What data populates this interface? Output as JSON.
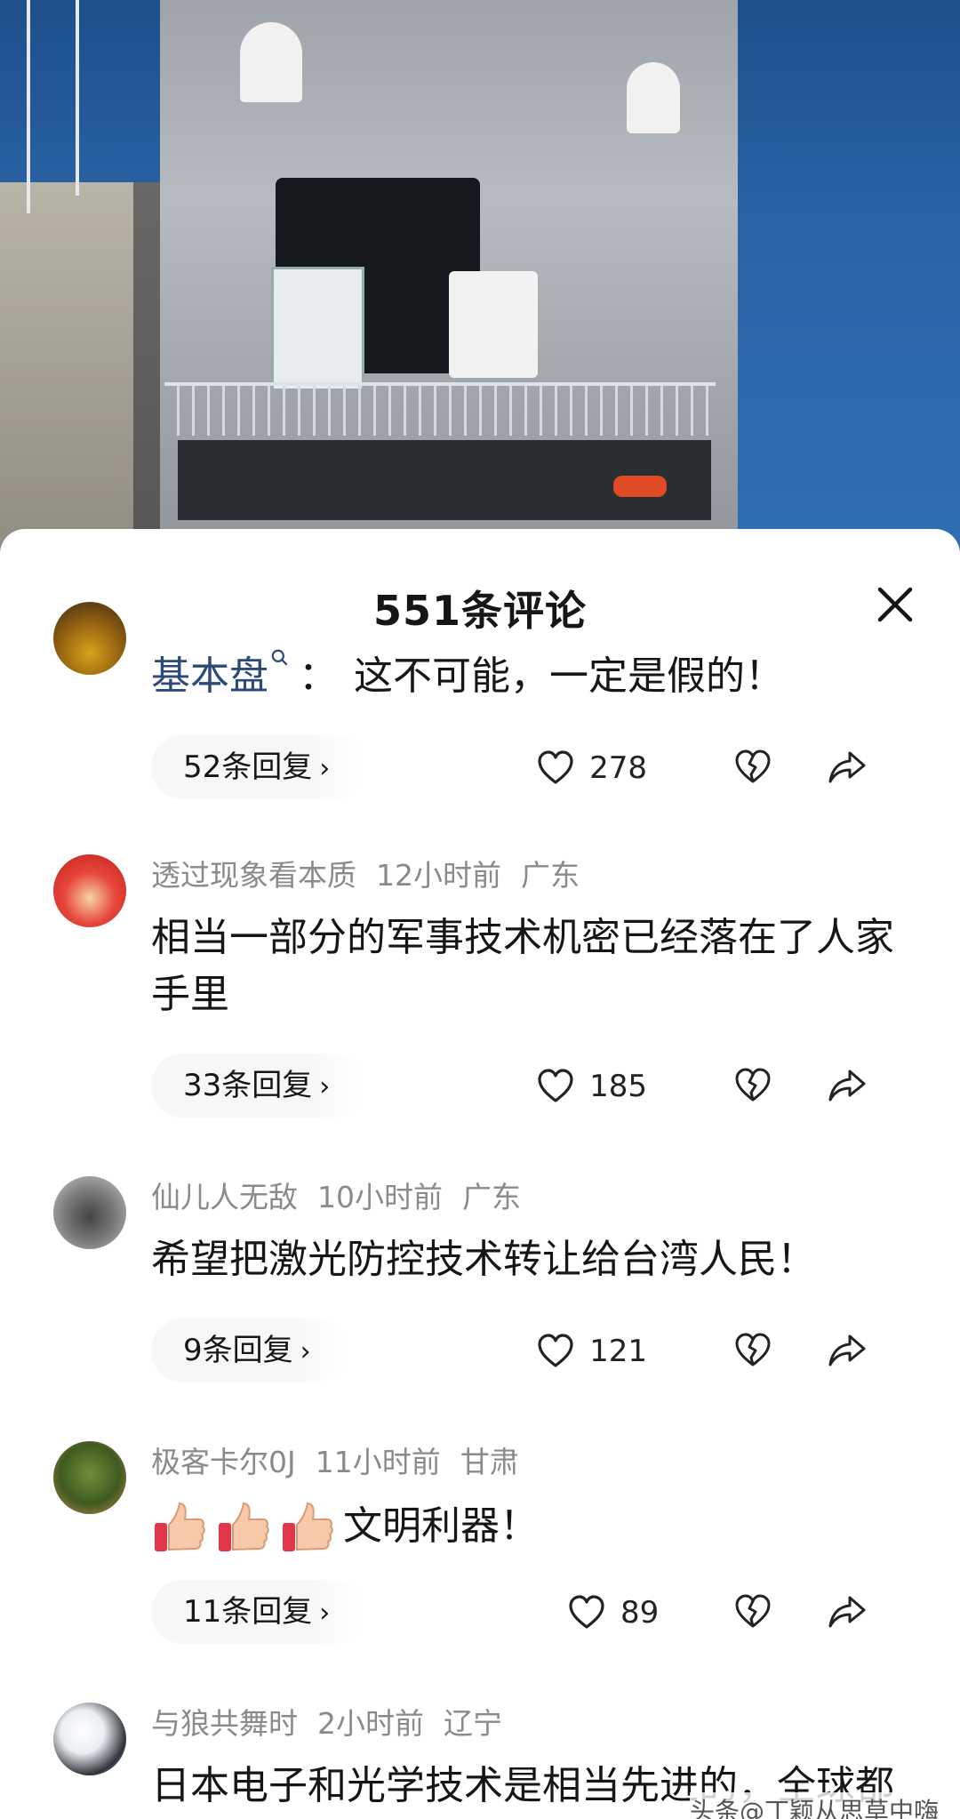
{
  "sheet": {
    "title": "551条评论"
  },
  "comments": [
    {
      "user": "基本盘",
      "text": "这不可能，一定是假的！",
      "replies": "52条回复",
      "likes": "278"
    },
    {
      "user": "透过现象看本质",
      "time": "12小时前",
      "location": "广东",
      "text": "相当一部分的军事技术机密已经落在了人家手里",
      "replies": "33条回复",
      "likes": "185"
    },
    {
      "user": "仙儿人无敌",
      "time": "10小时前",
      "location": "广东",
      "text": "希望把激光防控技术转让给台湾人民！",
      "replies": "9条回复",
      "likes": "121"
    },
    {
      "user": "极客卡尔0J",
      "time": "11小时前",
      "location": "甘肃",
      "text": "文明利器！",
      "replies": "11条回复",
      "likes": "89"
    },
    {
      "user": "与狼共舞时",
      "time": "2小时前",
      "location": "辽宁",
      "text": "日本电子和光学技术是相当先进的，全球都领先，我们可不能轻敌。"
    }
  ],
  "colon": "：",
  "chevron": "›",
  "watermark": "头条@丁颖从思草中嗨",
  "colors": {
    "username_link": "#2b4a78",
    "meta_gray": "#8a8a8a",
    "sea_blue": "#2a64a6"
  },
  "icons": [
    "close-icon",
    "heart-icon",
    "broken-heart-icon",
    "share-icon",
    "thumbs-up-emoji",
    "search-mini-icon"
  ]
}
